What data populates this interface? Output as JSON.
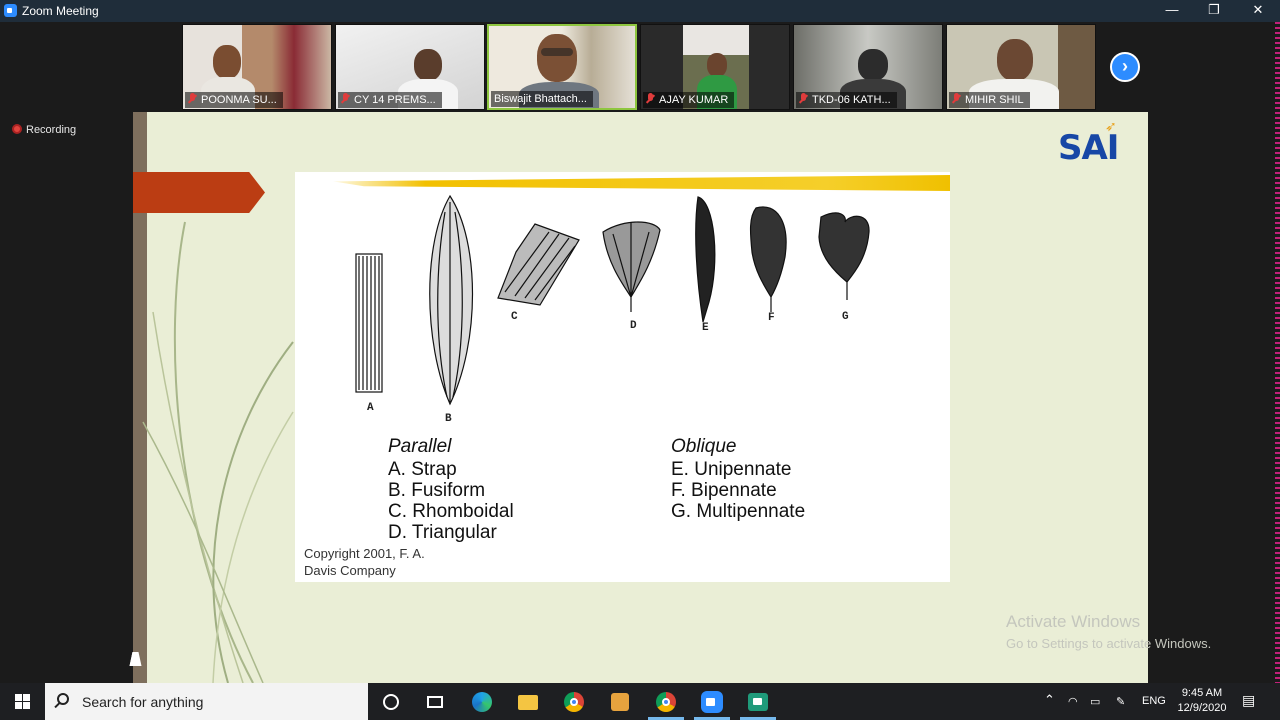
{
  "window": {
    "title": "Zoom Meeting",
    "minimize": "—",
    "restore": "❐",
    "close": "✕"
  },
  "participants": [
    {
      "name": "POONMA SU...",
      "muted": true,
      "bg": "#c9b8a6"
    },
    {
      "name": "CY 14 PREMS...",
      "muted": true,
      "bg": "#dcdcdc"
    },
    {
      "name": "Biswajit Bhattach...",
      "muted": false,
      "bg": "#d5cfc4"
    },
    {
      "name": "AJAY KUMAR",
      "muted": true,
      "bg": "#2a2a2a"
    },
    {
      "name": "TKD-06 KATH...",
      "muted": true,
      "bg": "#8d8f8a"
    },
    {
      "name": "MIHIR SHIL",
      "muted": true,
      "bg": "#b7b39f"
    }
  ],
  "gallery_next": "›",
  "recording": {
    "label": "Recording"
  },
  "slide": {
    "logo": "SAI",
    "figure_labels": [
      "A",
      "B",
      "C",
      "D",
      "E",
      "F",
      "G"
    ],
    "parallel": {
      "heading": "Parallel",
      "items": [
        "A.  Strap",
        "B.  Fusiform",
        "C.  Rhomboidal",
        "D.  Triangular"
      ]
    },
    "oblique": {
      "heading": "Oblique",
      "items": [
        "E.  Unipennate",
        "F.  Bipennate",
        "G.  Multipennate"
      ]
    },
    "copyright": "Copyright 2001, F. A. Davis Company"
  },
  "watermark": {
    "line1": "Activate Windows",
    "line2": "Go to Settings to activate Windows."
  },
  "taskbar": {
    "search_placeholder": "Search for anything",
    "language": "ENG",
    "time": "9:45 AM",
    "date": "12/9/2020"
  }
}
